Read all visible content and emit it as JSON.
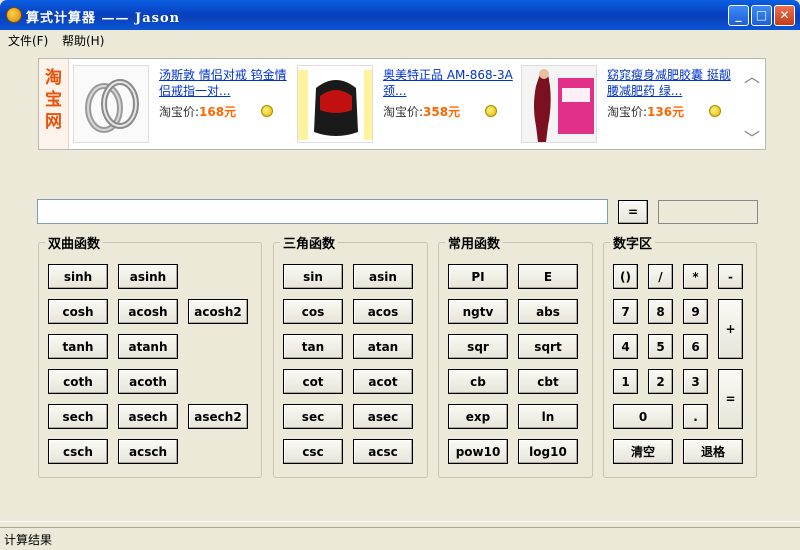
{
  "window": {
    "title": "算式计算器 —— Jason"
  },
  "menu": {
    "file": "文件(F)",
    "help": "帮助(H)"
  },
  "ads": {
    "logo_text": "淘宝网",
    "items": [
      {
        "title": "汤斯敦 情侣对戒 钨金情侣戒指一对...",
        "price_label": "淘宝价:",
        "price": "168元",
        "image": "ring-image"
      },
      {
        "title": "奥美特正品 AM-868-3A 颈...",
        "price_label": "淘宝价:",
        "price": "358元",
        "image": "massager-image",
        "image_text": "热销上千台 一年质保 好评如潮 终身维护"
      },
      {
        "title": "窈窕瘦身减肥胶囊 挺靓 腰减肥药 绿...",
        "price_label": "淘宝价:",
        "price": "136元",
        "image": "slimming-product-image"
      }
    ]
  },
  "calculator": {
    "expression": "",
    "equals_label": "=",
    "result": ""
  },
  "groups": {
    "hyperbolic": {
      "title": "双曲函数",
      "buttons": [
        "sinh",
        "asinh",
        "cosh",
        "acosh",
        "acosh2",
        "tanh",
        "atanh",
        "coth",
        "acoth",
        "sech",
        "asech",
        "asech2",
        "csch",
        "acsch"
      ]
    },
    "trig": {
      "title": "三角函数",
      "buttons": [
        "sin",
        "asin",
        "cos",
        "acos",
        "tan",
        "atan",
        "cot",
        "acot",
        "sec",
        "asec",
        "csc",
        "acsc"
      ]
    },
    "common": {
      "title": "常用函数",
      "buttons": [
        "PI",
        "E",
        "ngtv",
        "abs",
        "sqr",
        "sqrt",
        "cb",
        "cbt",
        "exp",
        "ln",
        "pow10",
        "log10"
      ]
    },
    "digits": {
      "title": "数字区",
      "buttons": [
        "()",
        "/",
        "*",
        "-",
        "7",
        "8",
        "9",
        "+",
        "4",
        "5",
        "6",
        "1",
        "2",
        "3",
        "=",
        "0",
        ".",
        "清空",
        "退格"
      ]
    }
  },
  "status": {
    "text": "计算结果"
  }
}
